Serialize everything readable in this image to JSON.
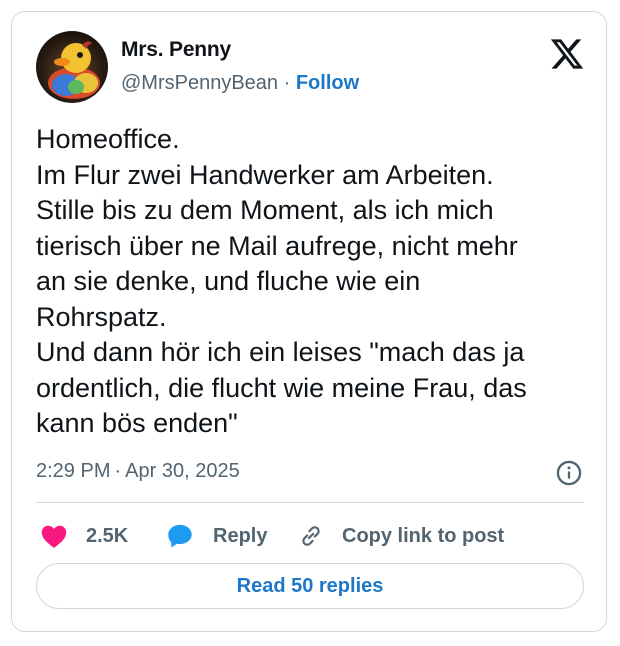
{
  "author": {
    "name": "Mrs. Penny",
    "handle": "@MrsPennyBean",
    "separator": "·",
    "follow_label": "Follow",
    "avatar_icon": "rubber-duck-avatar"
  },
  "tweet": {
    "lines": [
      "Homeoffice.",
      "Im Flur zwei Handwerker am Arbeiten.",
      "Stille bis zu dem Moment, als ich mich",
      "tierisch über ne Mail aufrege, nicht mehr",
      "an sie denke, und fluche wie ein",
      "Rohrspatz.",
      "Und dann hör ich ein leises \"mach das ja",
      "ordentlich, die flucht wie meine Frau, das",
      "kann bös enden\""
    ],
    "time": "2:29 PM",
    "separator": "·",
    "date": "Apr 30, 2025"
  },
  "actions": {
    "likes_count": "2.5K",
    "reply_label": "Reply",
    "copy_link_label": "Copy link to post"
  },
  "read_replies_label": "Read 50 replies",
  "colors": {
    "like": "#f91880",
    "reply": "#1d9bf0",
    "link": "#1d78c9",
    "muted": "#536471",
    "text": "#0f1419",
    "border": "#cfd9de"
  }
}
